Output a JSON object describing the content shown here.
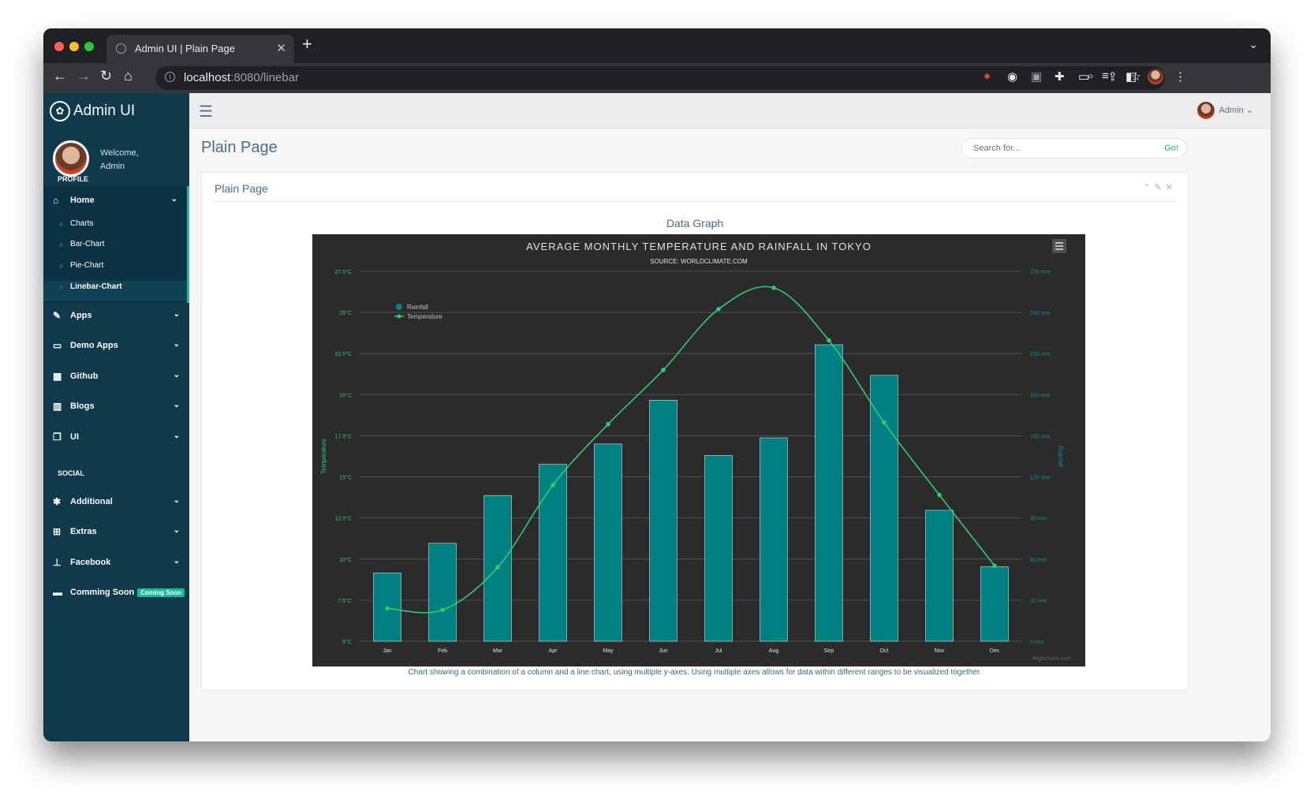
{
  "browser": {
    "tab_title": "Admin UI | Plain Page",
    "tab_close": "✕",
    "new_tab": "+",
    "url_host": "localhost",
    "url_rest": ":8080/linebar"
  },
  "sidebar": {
    "brand": "Admin UI",
    "welcome_line1": "Welcome,",
    "welcome_line2": "Admin",
    "profile": "PROFILE",
    "home": "Home",
    "subitems": [
      "Charts",
      "Bar-Chart",
      "Pie-Chart",
      "Linebar-Chart"
    ],
    "items": [
      "Apps",
      "Demo Apps",
      "Github",
      "Blogs",
      "UI"
    ],
    "social_heading": "SOCIAL",
    "social_items": [
      "Additional",
      "Extras",
      "Facebook"
    ],
    "coming_soon": "Comming Soon",
    "coming_soon_badge": "Coming Soon"
  },
  "topbar": {
    "user": "Admin"
  },
  "main": {
    "page_title": "Plain Page",
    "search_placeholder": "Search for...",
    "search_button": "Go!",
    "panel_title": "Plain Page",
    "graph_title": "Data Graph",
    "caption": "Chart showing a combination of a column and a line chart, using multiple y-axes. Using multiple axes allows for data within different ranges to be visualized together."
  },
  "colors": {
    "sidebar_bg": "#0e3a4c",
    "accent": "#1abb9c",
    "chart_bg": "#2b2b2b",
    "bar": "#008080",
    "line": "#2ecc71"
  },
  "chart_data": {
    "type": "bar",
    "title": "AVERAGE MONTHLY TEMPERATURE AND RAINFALL IN TOKYO",
    "subtitle": "SOURCE: WORLDCLIMATE.COM",
    "categories": [
      "Jan",
      "Feb",
      "Mar",
      "Apr",
      "May",
      "Jun",
      "Jul",
      "Aug",
      "Sep",
      "Oct",
      "Nov",
      "Dec"
    ],
    "series": [
      {
        "name": "Rainfall",
        "type": "column",
        "axis": "right",
        "unit": "mm",
        "values": [
          49.9,
          71.5,
          106.4,
          129.2,
          144.0,
          176.0,
          135.6,
          148.5,
          216.4,
          194.1,
          95.6,
          54.4
        ]
      },
      {
        "name": "Temperature",
        "type": "spline",
        "axis": "left",
        "unit": "°C",
        "values": [
          7.0,
          6.9,
          9.5,
          14.5,
          18.2,
          21.5,
          25.2,
          26.5,
          23.3,
          18.3,
          13.9,
          9.6
        ]
      }
    ],
    "y_left": {
      "label": "Temperature",
      "ylim": [
        5,
        27.5
      ],
      "ticks": [
        "5°C",
        "7.5°C",
        "10°C",
        "12.5°C",
        "15°C",
        "17.5°C",
        "20°C",
        "22.5°C",
        "25°C",
        "27.5°C"
      ]
    },
    "y_right": {
      "label": "Rainfall",
      "ylim": [
        0,
        270
      ],
      "ticks": [
        "0 mm",
        "30 mm",
        "60 mm",
        "90 mm",
        "120 mm",
        "150 mm",
        "180 mm",
        "210 mm",
        "240 mm",
        "270 mm"
      ]
    },
    "legend_position": "top-left",
    "credits": "Highcharts.com",
    "grid": true
  }
}
